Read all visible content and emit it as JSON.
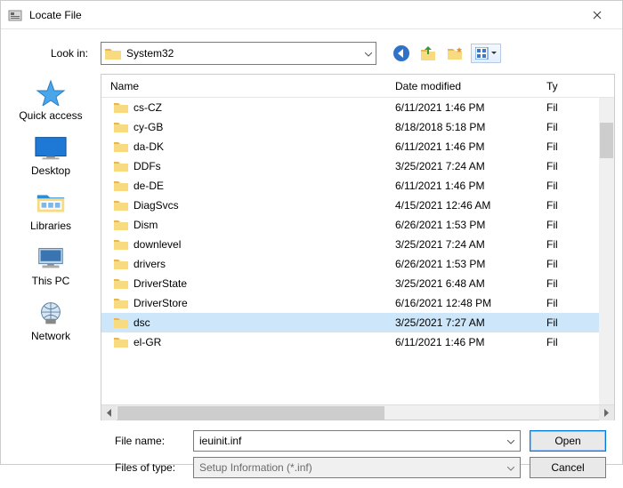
{
  "window": {
    "title": "Locate File"
  },
  "lookin": {
    "label": "Look in:",
    "value": "System32"
  },
  "columns": {
    "name": "Name",
    "date": "Date modified",
    "type": "Ty"
  },
  "rows": [
    {
      "name": "cs-CZ",
      "date": "6/11/2021 1:46 PM",
      "type": "Fil",
      "selected": false
    },
    {
      "name": "cy-GB",
      "date": "8/18/2018 5:18 PM",
      "type": "Fil",
      "selected": false
    },
    {
      "name": "da-DK",
      "date": "6/11/2021 1:46 PM",
      "type": "Fil",
      "selected": false
    },
    {
      "name": "DDFs",
      "date": "3/25/2021 7:24 AM",
      "type": "Fil",
      "selected": false
    },
    {
      "name": "de-DE",
      "date": "6/11/2021 1:46 PM",
      "type": "Fil",
      "selected": false
    },
    {
      "name": "DiagSvcs",
      "date": "4/15/2021 12:46 AM",
      "type": "Fil",
      "selected": false
    },
    {
      "name": "Dism",
      "date": "6/26/2021 1:53 PM",
      "type": "Fil",
      "selected": false
    },
    {
      "name": "downlevel",
      "date": "3/25/2021 7:24 AM",
      "type": "Fil",
      "selected": false
    },
    {
      "name": "drivers",
      "date": "6/26/2021 1:53 PM",
      "type": "Fil",
      "selected": false
    },
    {
      "name": "DriverState",
      "date": "3/25/2021 6:48 AM",
      "type": "Fil",
      "selected": false
    },
    {
      "name": "DriverStore",
      "date": "6/16/2021 12:48 PM",
      "type": "Fil",
      "selected": false
    },
    {
      "name": "dsc",
      "date": "3/25/2021 7:27 AM",
      "type": "Fil",
      "selected": true
    },
    {
      "name": "el-GR",
      "date": "6/11/2021 1:46 PM",
      "type": "Fil",
      "selected": false
    }
  ],
  "places": {
    "quick_access": "Quick access",
    "desktop": "Desktop",
    "libraries": "Libraries",
    "this_pc": "This PC",
    "network": "Network"
  },
  "filename": {
    "label": "File name:",
    "value": "ieuinit.inf"
  },
  "filetype": {
    "label": "Files of type:",
    "value": "Setup Information (*.inf)"
  },
  "buttons": {
    "open": "Open",
    "cancel": "Cancel"
  }
}
